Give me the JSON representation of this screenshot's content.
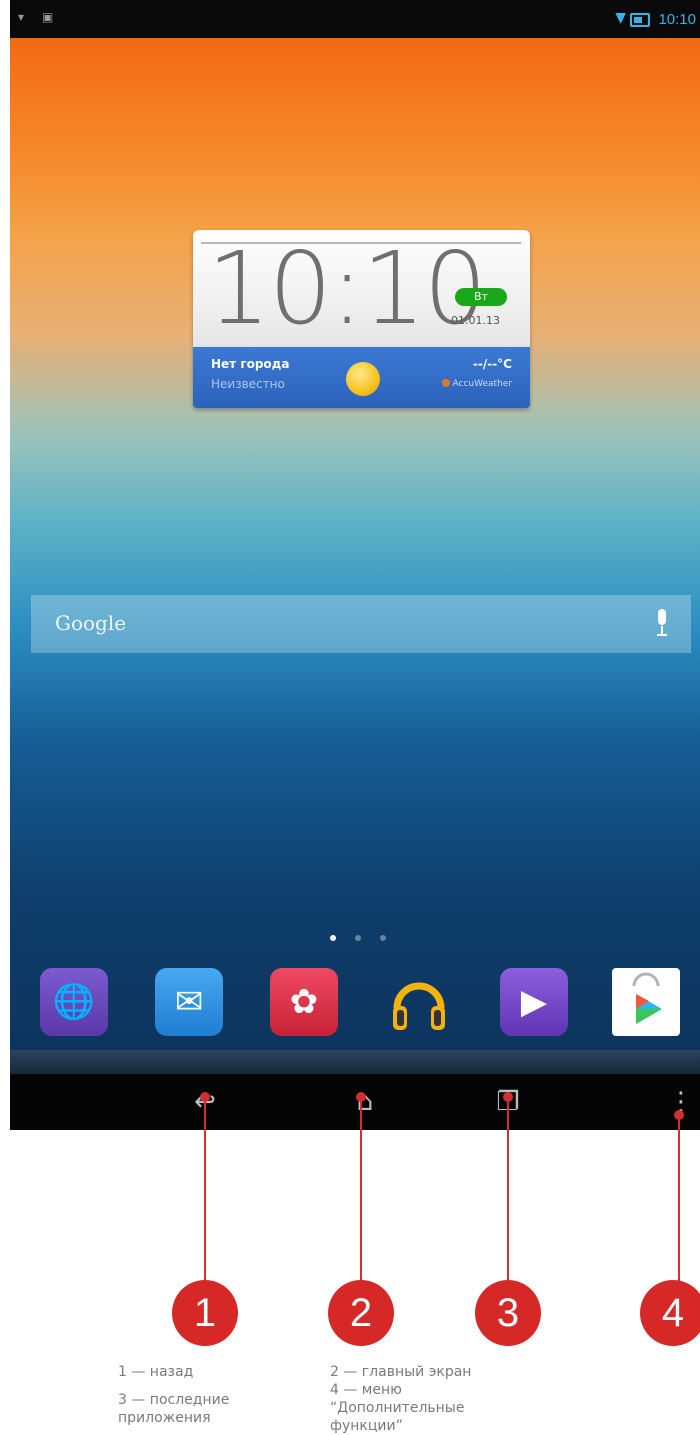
{
  "status_bar": {
    "time": "10:10",
    "icons": [
      "notification-icon",
      "screenshot-icon",
      "wifi-icon",
      "battery-icon"
    ],
    "accent_color": "#32b4e6"
  },
  "clock_widget": {
    "time": "10:10",
    "day": "Вт",
    "date": "01.01.13",
    "city": "Нет города",
    "condition": "Неизвестно",
    "temperature": "--/--°C",
    "provider": "AccuWeather"
  },
  "search_bar": {
    "label": "Google"
  },
  "home_pages": {
    "count": 3,
    "current": 1
  },
  "dock_apps": [
    {
      "icon": "browser-icon",
      "color": "#6a48b8"
    },
    {
      "icon": "email-icon",
      "color": "#2f8fe0"
    },
    {
      "icon": "gallery-icon",
      "color": "#e0304a"
    },
    {
      "icon": "music-headphones-icon",
      "color": "#f1b20f"
    },
    {
      "icon": "video-player-icon",
      "color": "#6d3fc2"
    },
    {
      "icon": "play-store-icon",
      "color": "#ffffff"
    }
  ],
  "nav_bar": {
    "buttons": [
      "back-icon",
      "home-icon",
      "recent-apps-icon",
      "menu-icon"
    ]
  },
  "annotations": {
    "markers": [
      "1",
      "2",
      "3",
      "4"
    ],
    "legend": {
      "back": "1 — назад",
      "home": "2 — главный экран",
      "recent_line1": "3 — последние",
      "recent_line2": "приложения",
      "menu_line1": "4 — меню",
      "menu_line2": "“Дополнительные",
      "menu_line3": "функции”"
    },
    "accent_color": "#d72828"
  }
}
